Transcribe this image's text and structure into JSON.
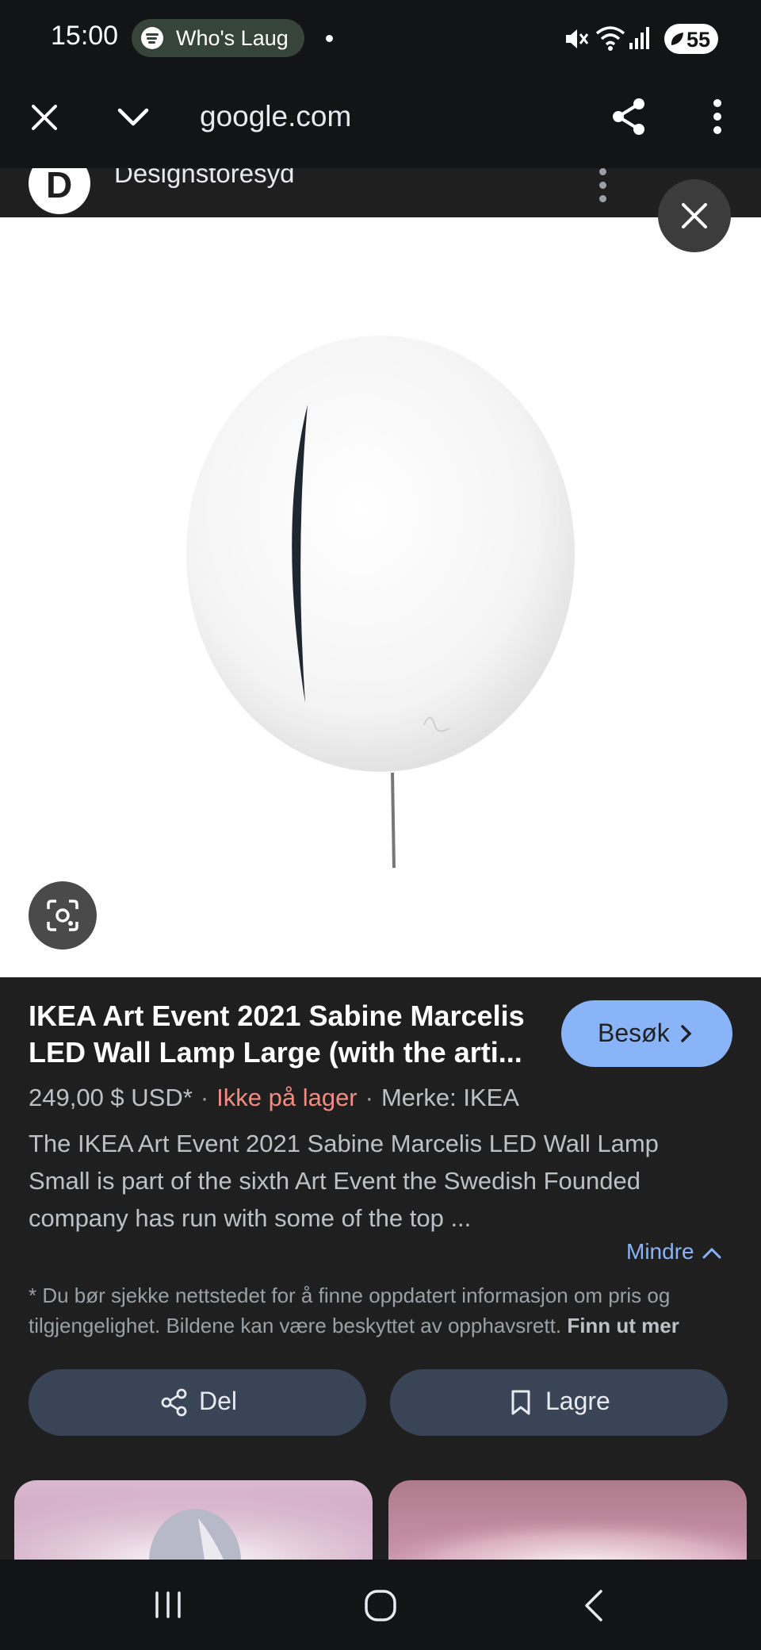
{
  "status_bar": {
    "time": "15:00",
    "media_label": "Who's Laug",
    "battery": "55",
    "icons": [
      "mute-icon",
      "wifi-icon",
      "signal-icon",
      "battery-icon"
    ]
  },
  "browser": {
    "url": "google.com",
    "icons": [
      "close-icon",
      "chevron-down-icon",
      "share-icon",
      "more-vert-icon"
    ]
  },
  "source": {
    "logo_letter": "D",
    "name": "Designstoresyd"
  },
  "product": {
    "title_line1": "IKEA Art Event 2021 Sabine Marcelis",
    "title_line2": "LED Wall Lamp Large (with the arti...",
    "visit_label": "Besøk",
    "price": "249,00 $ USD*",
    "stock": "Ikke på lager",
    "brand": "Merke: IKEA",
    "meta_separator": "·",
    "description": "The IKEA Art Event 2021 Sabine Marcelis LED Wall Lamp Small is part of the sixth Art Event the Swedish Founded company has run with some of the top ...",
    "less_label": "Mindre",
    "disclaimer_text": "* Du bør sjekke nettstedet for å finne oppdatert informasjon om pris og tilgjengelighet. Bildene kan være beskyttet av opphavsrett.",
    "learn_more": "Finn ut mer"
  },
  "actions": {
    "share_label": "Del",
    "save_label": "Lagre"
  },
  "colors": {
    "accent": "#8ab4f8",
    "out_of_stock": "#f28b82",
    "action_button": "#394457"
  }
}
